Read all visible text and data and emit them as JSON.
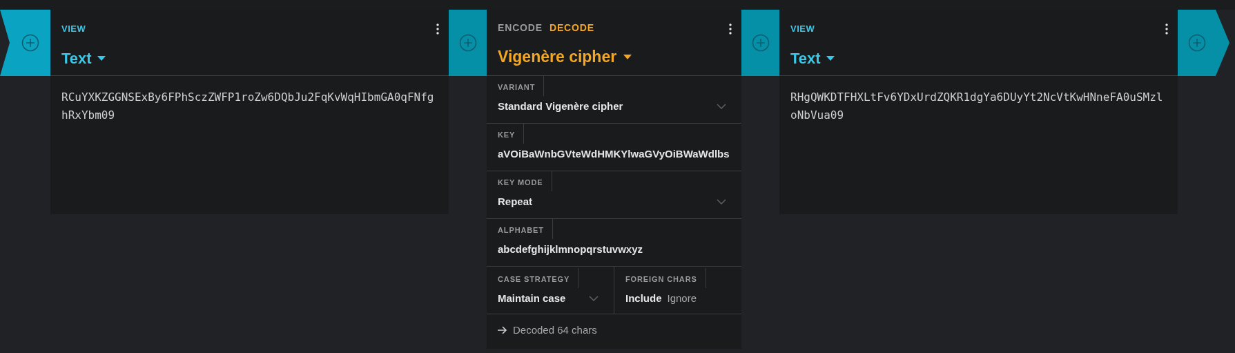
{
  "pipeline": [
    {
      "kind": "view",
      "mode_label": "VIEW",
      "format": "Text",
      "content": "RCuYXKZGGNSExBy6FPhSczZWFP1roZw6DQbJu2FqKvWqHIbmGA0qFNfghRxYbm09"
    },
    {
      "kind": "operation",
      "tabs": [
        {
          "label": "ENCODE",
          "selected": false
        },
        {
          "label": "DECODE",
          "selected": true
        }
      ],
      "title": "Vigenère cipher",
      "settings": [
        {
          "kind": "select",
          "label": "VARIANT",
          "value": "Standard Vigenère cipher"
        },
        {
          "kind": "text",
          "label": "KEY",
          "value": "aVOiBaWnbGVteWdHMKYlwaGVyOiBWaWdlbs"
        },
        {
          "kind": "select",
          "label": "KEY MODE",
          "value": "Repeat"
        },
        {
          "kind": "text",
          "label": "ALPHABET",
          "value": "abcdefghijklmnopqrstuvwxyz"
        }
      ],
      "options_row": [
        {
          "kind": "select",
          "label": "CASE STRATEGY",
          "value": "Maintain case"
        },
        {
          "kind": "toggle",
          "label": "FOREIGN CHARS",
          "options": [
            {
              "label": "Include",
              "selected": true
            },
            {
              "label": "Ignore",
              "selected": false
            }
          ]
        }
      ],
      "status": "Decoded 64 chars"
    },
    {
      "kind": "view",
      "mode_label": "VIEW",
      "format": "Text",
      "content": "RHgQWKDTFHXLtFv6YDxUrdZQKR1dgYa6DUyYt2NcVtKwHNneFA0uSMzloNbVua09"
    }
  ]
}
